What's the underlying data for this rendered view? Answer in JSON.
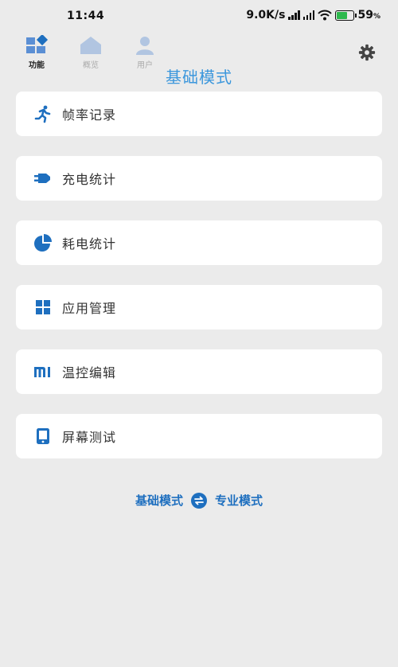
{
  "status_bar": {
    "time": "11:44",
    "network_speed": "9.0K/s",
    "battery_percent": "59",
    "battery_percent_sign": "%",
    "battery_level": 0.59,
    "icons": [
      "signal-icon",
      "signal-icon",
      "wifi-icon",
      "battery-icon"
    ]
  },
  "tabs": [
    {
      "label": "功能",
      "icon": "grid-icon",
      "active": true
    },
    {
      "label": "概览",
      "icon": "home-icon",
      "active": false
    },
    {
      "label": "用户",
      "icon": "user-icon",
      "active": false
    }
  ],
  "settings_icon": "gear-icon",
  "page_title": "基础模式",
  "menu_items": [
    {
      "label": "帧率记录",
      "icon": "running-icon"
    },
    {
      "label": "充电统计",
      "icon": "charger-icon"
    },
    {
      "label": "耗电统计",
      "icon": "pie-chart-icon"
    },
    {
      "label": "应用管理",
      "icon": "apps-grid-icon"
    },
    {
      "label": "温控编辑",
      "icon": "mi-logo-icon"
    },
    {
      "label": "屏幕测试",
      "icon": "tablet-icon"
    }
  ],
  "mode_switch": {
    "left_label": "基础模式",
    "right_label": "专业模式",
    "icon": "swap-icon"
  },
  "colors": {
    "accent": "#3c97dc",
    "icon_blue": "#1e6fbf",
    "background": "#ebebeb",
    "card": "#ffffff"
  }
}
